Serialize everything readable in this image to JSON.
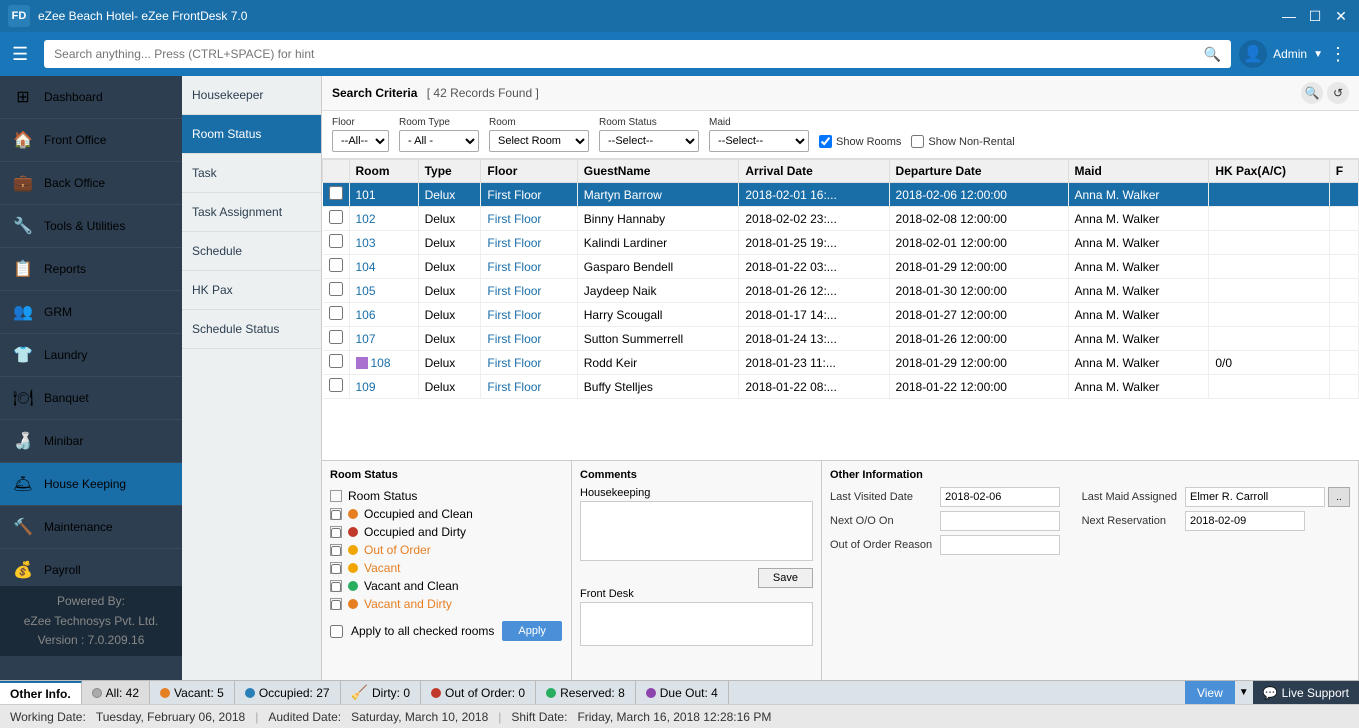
{
  "titleBar": {
    "icon": "FD",
    "title": "eZee Beach Hotel- eZee FrontDesk 7.0",
    "minBtn": "—",
    "maxBtn": "☐",
    "closeBtn": "✕"
  },
  "searchBar": {
    "placeholder": "Search anything... Press (CTRL+SPACE) for hint",
    "userName": "Admin"
  },
  "sidebar": {
    "items": [
      {
        "id": "dashboard",
        "label": "Dashboard",
        "icon": "⊞"
      },
      {
        "id": "front-office",
        "label": "Front Office",
        "icon": "🏠"
      },
      {
        "id": "back-office",
        "label": "Back Office",
        "icon": "💼"
      },
      {
        "id": "tools-utilities",
        "label": "Tools & Utilities",
        "icon": "🔧"
      },
      {
        "id": "reports",
        "label": "Reports",
        "icon": "📋"
      },
      {
        "id": "grm",
        "label": "GRM",
        "icon": "👥"
      },
      {
        "id": "laundry",
        "label": "Laundry",
        "icon": "👕"
      },
      {
        "id": "banquet",
        "label": "Banquet",
        "icon": "🍽"
      },
      {
        "id": "minibar",
        "label": "Minibar",
        "icon": "🍶"
      },
      {
        "id": "house-keeping",
        "label": "House Keeping",
        "icon": "🛎"
      },
      {
        "id": "maintenance",
        "label": "Maintenance",
        "icon": "🔨"
      },
      {
        "id": "payroll",
        "label": "Payroll",
        "icon": "💰"
      }
    ]
  },
  "subSidebar": {
    "items": [
      {
        "id": "housekeeper",
        "label": "Housekeeper"
      },
      {
        "id": "room-status",
        "label": "Room Status"
      },
      {
        "id": "task",
        "label": "Task"
      },
      {
        "id": "task-assignment",
        "label": "Task Assignment"
      },
      {
        "id": "schedule",
        "label": "Schedule"
      },
      {
        "id": "hk-pax",
        "label": "HK Pax"
      },
      {
        "id": "schedule-status",
        "label": "Schedule Status"
      }
    ]
  },
  "searchCriteria": {
    "title": "Search Criteria",
    "records": "[ 42 Records Found ]"
  },
  "filters": {
    "floorLabel": "Floor",
    "floorDefault": "--All--",
    "roomTypeLabel": "Room Type",
    "roomTypeDefault": "- All -",
    "roomLabel": "Room",
    "roomDefault": "Select Room",
    "roomStatusLabel": "Room Status",
    "roomStatusDefault": "--Select--",
    "maidLabel": "Maid",
    "maidDefault": "--Select--",
    "showRoomsLabel": "Show Rooms",
    "showNonRentalLabel": "Show Non-Rental"
  },
  "tableHeaders": [
    "",
    "Room",
    "Type",
    "Floor",
    "GuestName",
    "Arrival Date",
    "Departure Date",
    "Maid",
    "HK Pax(A/C)",
    "F"
  ],
  "tableRows": [
    {
      "room": "101",
      "type": "Delux",
      "floor": "First Floor",
      "guest": "Martyn Barrow",
      "arrival": "2018-02-01 16:...",
      "departure": "2018-02-06 12:00:00",
      "maid": "Anna M. Walker",
      "hkpax": "",
      "selected": true
    },
    {
      "room": "102",
      "type": "Delux",
      "floor": "First Floor",
      "guest": "Binny Hannaby",
      "arrival": "2018-02-02 23:...",
      "departure": "2018-02-08 12:00:00",
      "maid": "Anna M. Walker",
      "hkpax": "",
      "selected": false
    },
    {
      "room": "103",
      "type": "Delux",
      "floor": "First Floor",
      "guest": "Kalindi Lardiner",
      "arrival": "2018-01-25 19:...",
      "departure": "2018-02-01 12:00:00",
      "maid": "Anna M. Walker",
      "hkpax": "",
      "selected": false
    },
    {
      "room": "104",
      "type": "Delux",
      "floor": "First Floor",
      "guest": "Gasparo Bendell",
      "arrival": "2018-01-22 03:...",
      "departure": "2018-01-29 12:00:00",
      "maid": "Anna M. Walker",
      "hkpax": "",
      "selected": false
    },
    {
      "room": "105",
      "type": "Delux",
      "floor": "First Floor",
      "guest": "Jaydeep Naik",
      "arrival": "2018-01-26 12:...",
      "departure": "2018-01-30 12:00:00",
      "maid": "Anna M. Walker",
      "hkpax": "",
      "selected": false
    },
    {
      "room": "106",
      "type": "Delux",
      "floor": "First Floor",
      "guest": "Harry Scougall",
      "arrival": "2018-01-17 14:...",
      "departure": "2018-01-27 12:00:00",
      "maid": "Anna M. Walker",
      "hkpax": "",
      "selected": false
    },
    {
      "room": "107",
      "type": "Delux",
      "floor": "First Floor",
      "guest": "Sutton Summerrell",
      "arrival": "2018-01-24 13:...",
      "departure": "2018-01-26 12:00:00",
      "maid": "Anna M. Walker",
      "hkpax": "",
      "selected": false
    },
    {
      "room": "108",
      "type": "Delux",
      "floor": "First Floor",
      "guest": "Rodd Keir",
      "arrival": "2018-01-23 11:...",
      "departure": "2018-01-29 12:00:00",
      "maid": "Anna M. Walker",
      "hkpax": "0/0",
      "selected": false,
      "purple": true
    },
    {
      "room": "109",
      "type": "Delux",
      "floor": "First Floor",
      "guest": "Buffy Stelljes",
      "arrival": "2018-01-22 08:...",
      "departure": "2018-01-22 12:00:00",
      "maid": "Anna M. Walker",
      "hkpax": "",
      "selected": false
    }
  ],
  "bottomPanels": {
    "roomStatus": {
      "title": "Room Status",
      "headerCheck": "Room Status",
      "statuses": [
        {
          "label": "Occupied and Clean",
          "color": "orange"
        },
        {
          "label": "Occupied and Dirty",
          "color": "dark-orange"
        },
        {
          "label": "Out of Order",
          "color": "yellow"
        },
        {
          "label": "Vacant",
          "color": "yellow"
        },
        {
          "label": "Vacant and Clean",
          "color": "green"
        },
        {
          "label": "Vacant and Dirty",
          "color": "orange"
        }
      ],
      "applyAllLabel": "Apply to all checked rooms",
      "applyBtn": "Apply"
    },
    "comments": {
      "title": "Comments",
      "housekeepingLabel": "Housekeeping",
      "saveBtn": "Save",
      "frontDeskLabel": "Front Desk"
    },
    "otherInfo": {
      "title": "Other Information",
      "lastVisitedDateLabel": "Last Visited Date",
      "lastVisitedDateValue": "2018-02-06",
      "lastMaidAssignedLabel": "Last Maid Assigned",
      "lastMaidAssignedValue": "Elmer R. Carroll",
      "nextOOLabel": "Next O/O On",
      "nextOOValue": "",
      "nextReservationLabel": "Next Reservation",
      "nextReservationValue": "2018-02-09",
      "outOfOrderLabel": "Out of Order Reason",
      "outOfOrderValue": ""
    }
  },
  "footerTabs": [
    {
      "label": "Other Info.",
      "active": true
    },
    {
      "dot": "white",
      "label": "All: 42",
      "color": "#888"
    },
    {
      "dot": "#e67e22",
      "label": "Vacant: 5"
    },
    {
      "dot": "#2980b9",
      "label": "Occupied: 27"
    },
    {
      "dot": "#c8a000",
      "label": "Dirty: 0"
    },
    {
      "dot": "#c0392b",
      "label": "Out of Order: 0"
    },
    {
      "dot": "#27ae60",
      "label": "Reserved: 8"
    },
    {
      "dot": "#8e44ad",
      "label": "Due Out: 4"
    }
  ],
  "footerView": "View",
  "statusBar": {
    "workingDate": "Working Date:",
    "workingDateValue": "Tuesday, February 06, 2018",
    "auditedDate": "Audited Date:",
    "auditedDateValue": "Saturday, March 10, 2018",
    "shiftDate": "Shift Date:",
    "shiftDateValue": "Friday, March 16, 2018 12:28:16 PM"
  },
  "liveSupport": "Live Support",
  "poweredBy": {
    "line1": "Powered By:",
    "line2": "eZee Technosys Pvt. Ltd.",
    "line3": "Version : 7.0.209.16"
  }
}
